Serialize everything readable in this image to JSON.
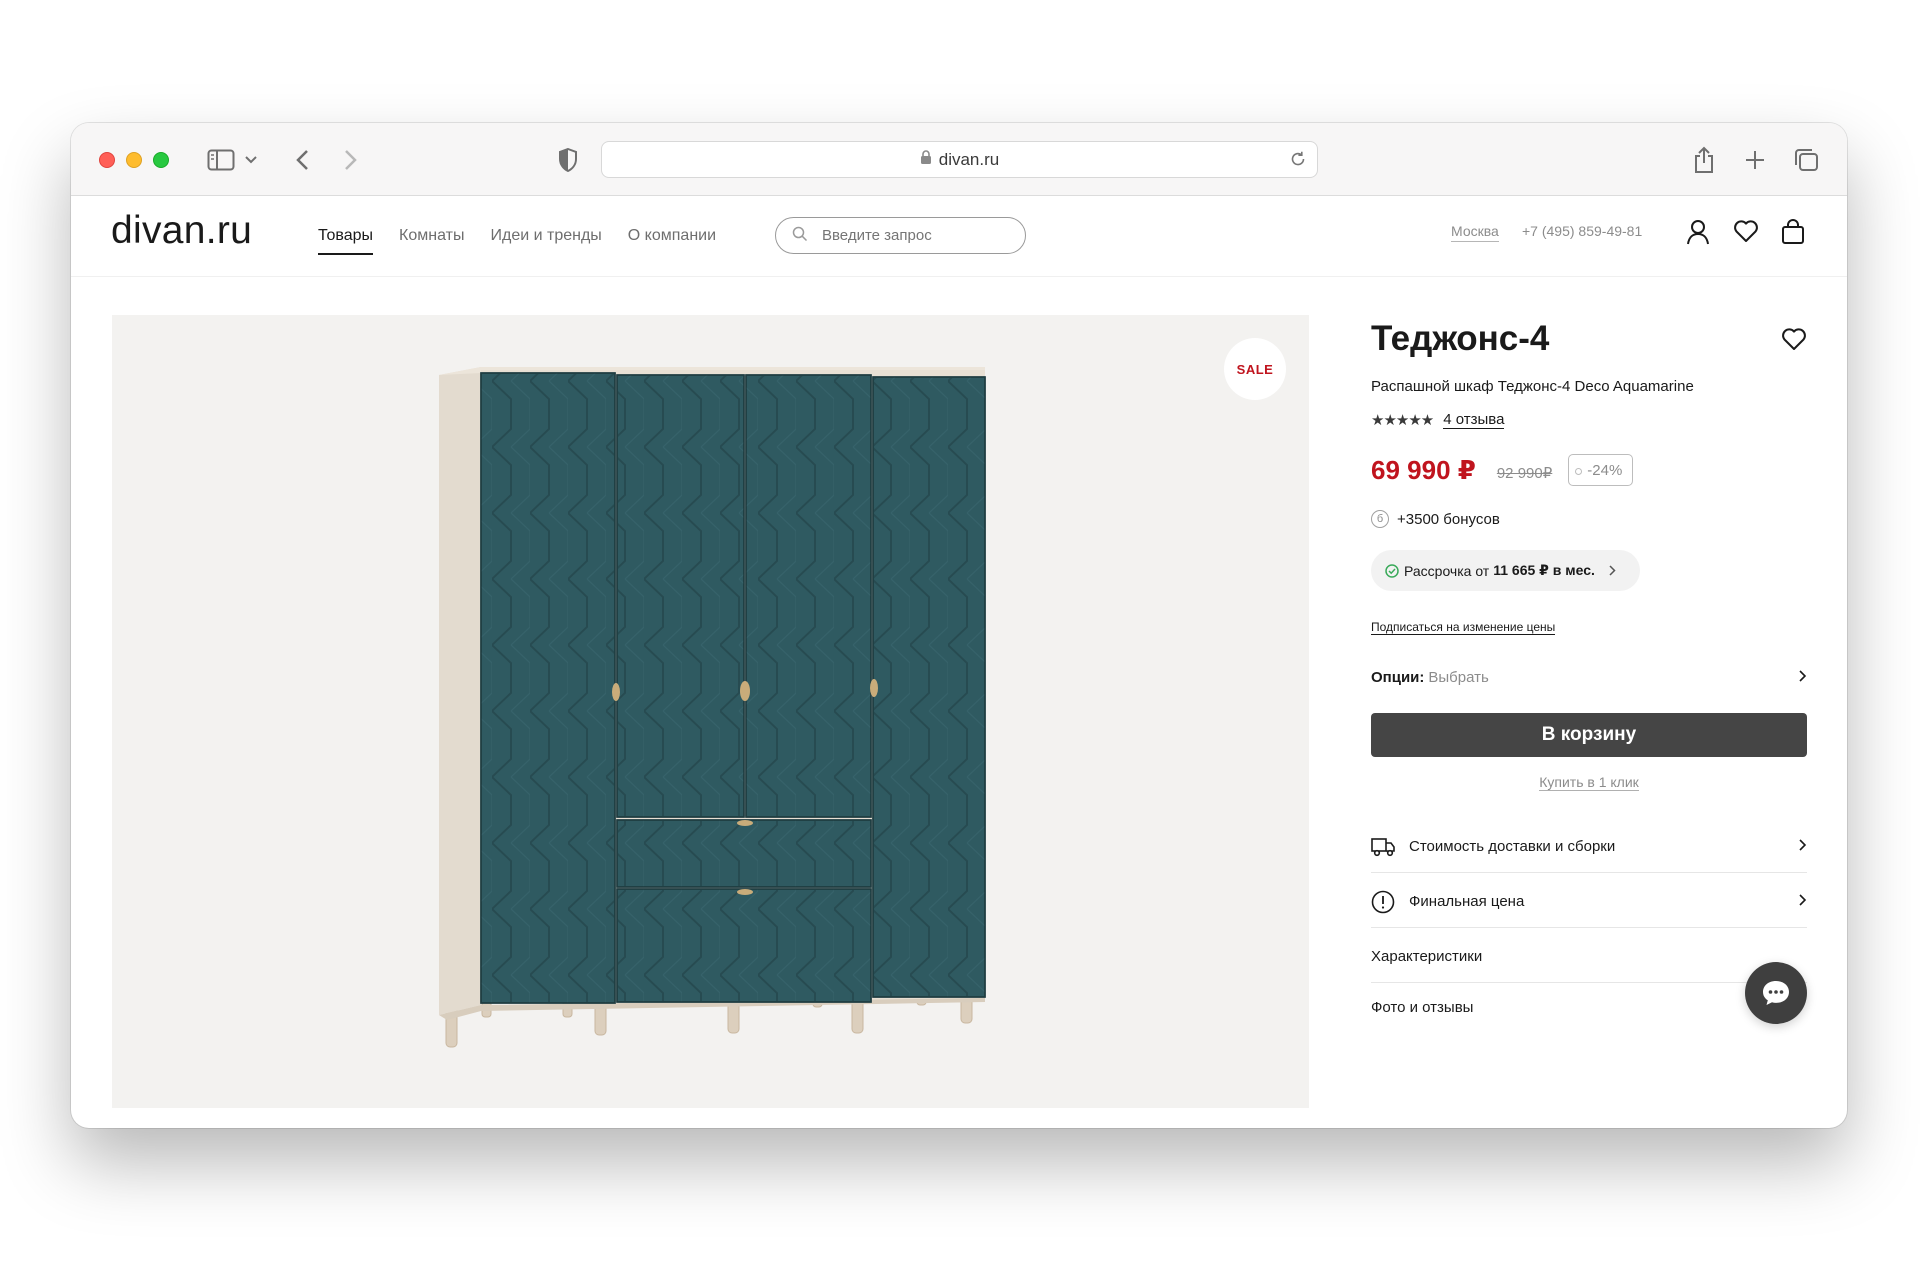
{
  "browser": {
    "url": "divan.ru"
  },
  "site": {
    "logo": "divan.ru",
    "nav": [
      {
        "label": "Товары",
        "active": true
      },
      {
        "label": "Комнаты",
        "active": false
      },
      {
        "label": "Идеи и тренды",
        "active": false
      },
      {
        "label": "О компании",
        "active": false
      }
    ],
    "search_placeholder": "Введите запрос",
    "city": "Москва",
    "phone": "+7 (495) 859-49-81"
  },
  "product": {
    "badge": "SALE",
    "title": "Теджонс-4",
    "subtitle": "Распашной шкаф Теджонс-4 Deco Aquamarine",
    "stars": "★★★★★",
    "rating": 5,
    "reviews": "4 отзыва",
    "price": "69 990 ₽",
    "old_price": "92 990₽",
    "discount": "-24%",
    "bonus_icon": "б",
    "bonus": "+3500 бонусов",
    "installment_prefix": "Рассрочка от",
    "installment_amount": "11 665 ₽ в мес.",
    "subscribe": "Подписаться на изменение цены",
    "options_label": "Опции:",
    "options_value": "Выбрать",
    "cart_button": "В корзину",
    "one_click": "Купить в 1 клик",
    "info_rows": [
      {
        "label": "Стоимость доставки и сборки",
        "icon": "truck-icon"
      },
      {
        "label": "Финальная цена",
        "icon": "exclamation-icon"
      },
      {
        "label": "Характеристики"
      },
      {
        "label": "Фото и отзывы"
      }
    ]
  },
  "colors": {
    "price_red": "#c0141e",
    "cabinet_teal": "#2f5a61",
    "wood": "#e3dbcf",
    "button_dark": "#454545"
  }
}
